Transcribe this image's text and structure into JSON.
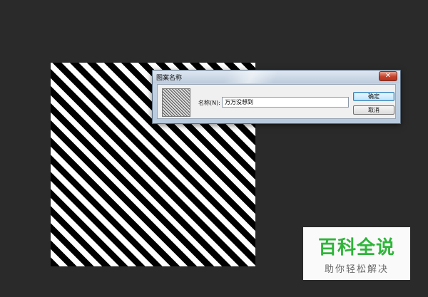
{
  "dialog": {
    "title": "图案名称",
    "close_label": "✕",
    "name_label": "名称(N):",
    "name_value": "万万没想到",
    "ok_label": "确定",
    "cancel_label": "取消"
  },
  "watermark": {
    "title": "百科全说",
    "subtitle": "助你轻松解决"
  }
}
